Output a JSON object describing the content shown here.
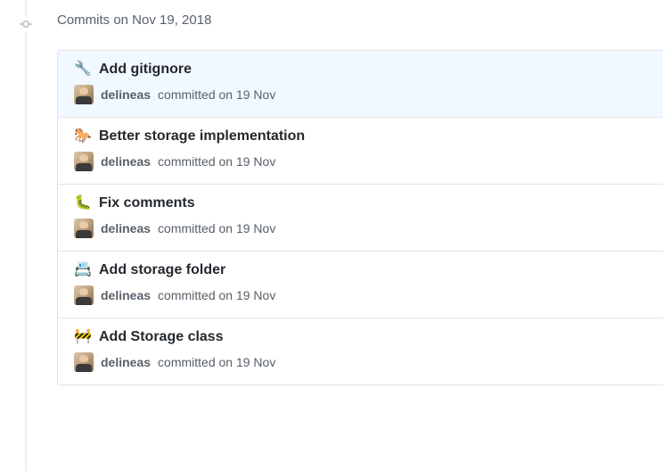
{
  "date_header": "Commits on Nov 19, 2018",
  "commits": [
    {
      "emoji": "🔧",
      "title": "Add gitignore",
      "author": "delineas",
      "meta": "committed on 19 Nov",
      "highlighted": true,
      "emoji_class": "wrench-icon"
    },
    {
      "emoji": "🐎",
      "title": "Better storage implementation",
      "author": "delineas",
      "meta": "committed on 19 Nov",
      "highlighted": false,
      "emoji_class": ""
    },
    {
      "emoji": "🐛",
      "title": "Fix comments",
      "author": "delineas",
      "meta": "committed on 19 Nov",
      "highlighted": false,
      "emoji_class": ""
    },
    {
      "emoji": "📇",
      "title": "Add storage folder",
      "author": "delineas",
      "meta": "committed on 19 Nov",
      "highlighted": false,
      "emoji_class": ""
    },
    {
      "emoji": "🚧",
      "title": "Add Storage class",
      "author": "delineas",
      "meta": "committed on 19 Nov",
      "highlighted": false,
      "emoji_class": ""
    }
  ]
}
